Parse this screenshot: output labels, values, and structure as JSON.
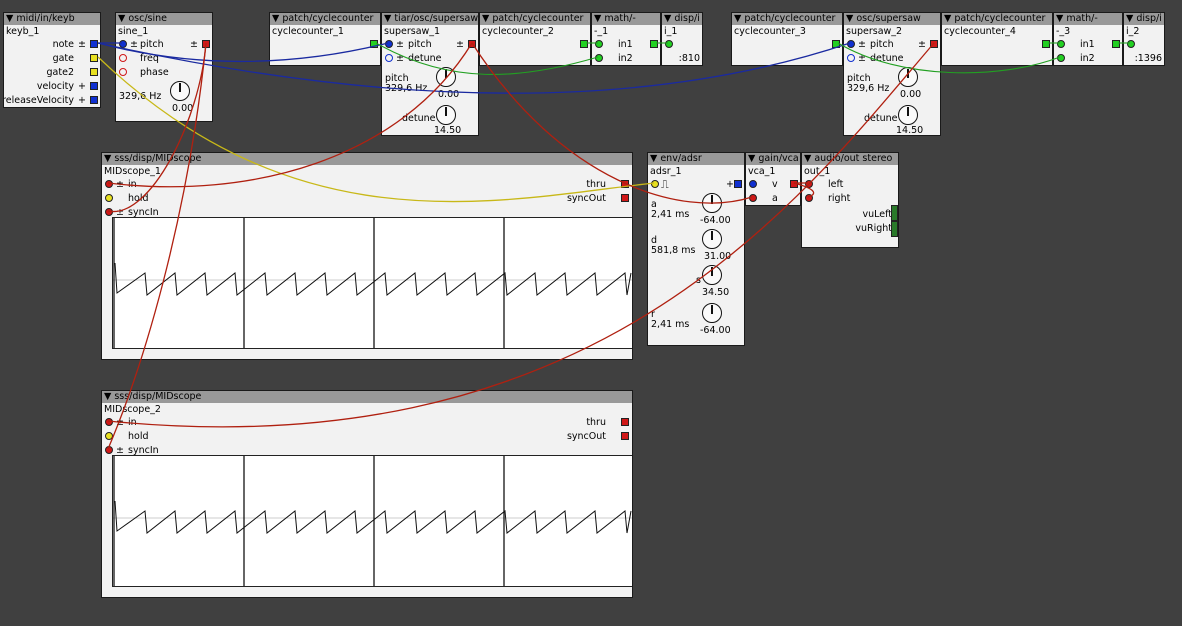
{
  "objects": {
    "keyb": {
      "type": "midi/in/keyb",
      "name": "keyb_1",
      "outlets": [
        "note",
        "gate",
        "gate2",
        "velocity",
        "releaseVelocity"
      ]
    },
    "sine": {
      "type": "osc/sine",
      "name": "sine_1",
      "inlets": [
        "pitch",
        "freq",
        "phase"
      ],
      "pitch_value": "329,6 Hz",
      "knob_value": "0.00"
    },
    "cc1": {
      "type": "patch/cyclecounter",
      "name": "cyclecounter_1"
    },
    "ss1": {
      "type": "tiar/osc/supersaw",
      "name": "supersaw_1",
      "inlets": [
        "pitch",
        "detune"
      ],
      "pitch_label": "pitch",
      "pitch_value": "329,6 Hz",
      "pitch_knob": "0.00",
      "detune_label": "detune",
      "detune_knob": "14.50"
    },
    "cc2": {
      "type": "patch/cyclecounter",
      "name": "cyclecounter_2"
    },
    "math1": {
      "type": "math/-",
      "name": "-_1",
      "inlets": [
        "in1",
        "in2"
      ]
    },
    "disp1": {
      "type": "disp/i",
      "name": "i_1",
      "value": ":810"
    },
    "cc3": {
      "type": "patch/cyclecounter",
      "name": "cyclecounter_3"
    },
    "ss2": {
      "type": "osc/supersaw",
      "name": "supersaw_2",
      "inlets": [
        "pitch",
        "detune"
      ],
      "pitch_label": "pitch",
      "pitch_value": "329,6 Hz",
      "pitch_knob": "0.00",
      "detune_label": "detune",
      "detune_knob": "14.50"
    },
    "cc4": {
      "type": "patch/cyclecounter",
      "name": "cyclecounter_4"
    },
    "math3": {
      "type": "math/-",
      "name": "-_3",
      "inlets": [
        "in1",
        "in2"
      ]
    },
    "disp2": {
      "type": "disp/i",
      "name": "i_2",
      "value": ":1396"
    },
    "scope1": {
      "type": "sss/disp/MIDscope",
      "name": "MIDscope_1",
      "inlets": [
        "in",
        "hold",
        "syncIn"
      ],
      "outlets": [
        "thru",
        "syncOut"
      ]
    },
    "scope2": {
      "type": "sss/disp/MIDscope",
      "name": "MIDscope_2",
      "inlets": [
        "in",
        "hold",
        "syncIn"
      ],
      "outlets": [
        "thru",
        "syncOut"
      ]
    },
    "adsr": {
      "type": "env/adsr",
      "name": "adsr_1",
      "params": [
        {
          "label": "a",
          "value": "2,41 ms",
          "knob": "-64.00"
        },
        {
          "label": "d",
          "value": "581,8 ms",
          "knob": "31.00"
        },
        {
          "label": "s",
          "value": "",
          "knob": "34.50"
        },
        {
          "label": "r",
          "value": "2,41 ms",
          "knob": "-64.00"
        }
      ]
    },
    "vca": {
      "type": "gain/vca",
      "name": "vca_1",
      "inlets": [
        "v",
        "a"
      ]
    },
    "out": {
      "type": "audio/out stereo",
      "name": "out_1",
      "inlets": [
        "left",
        "right"
      ],
      "vu": [
        "vuLeft",
        "vuRight"
      ]
    }
  },
  "glyphs": {
    "plusminus": "±",
    "triangle": "▼"
  },
  "colors": {
    "background": "#404040",
    "wire_red": "#b02010",
    "wire_blue": "#1a2aa0",
    "wire_green": "#22a022",
    "wire_yellow": "#c8b818"
  }
}
